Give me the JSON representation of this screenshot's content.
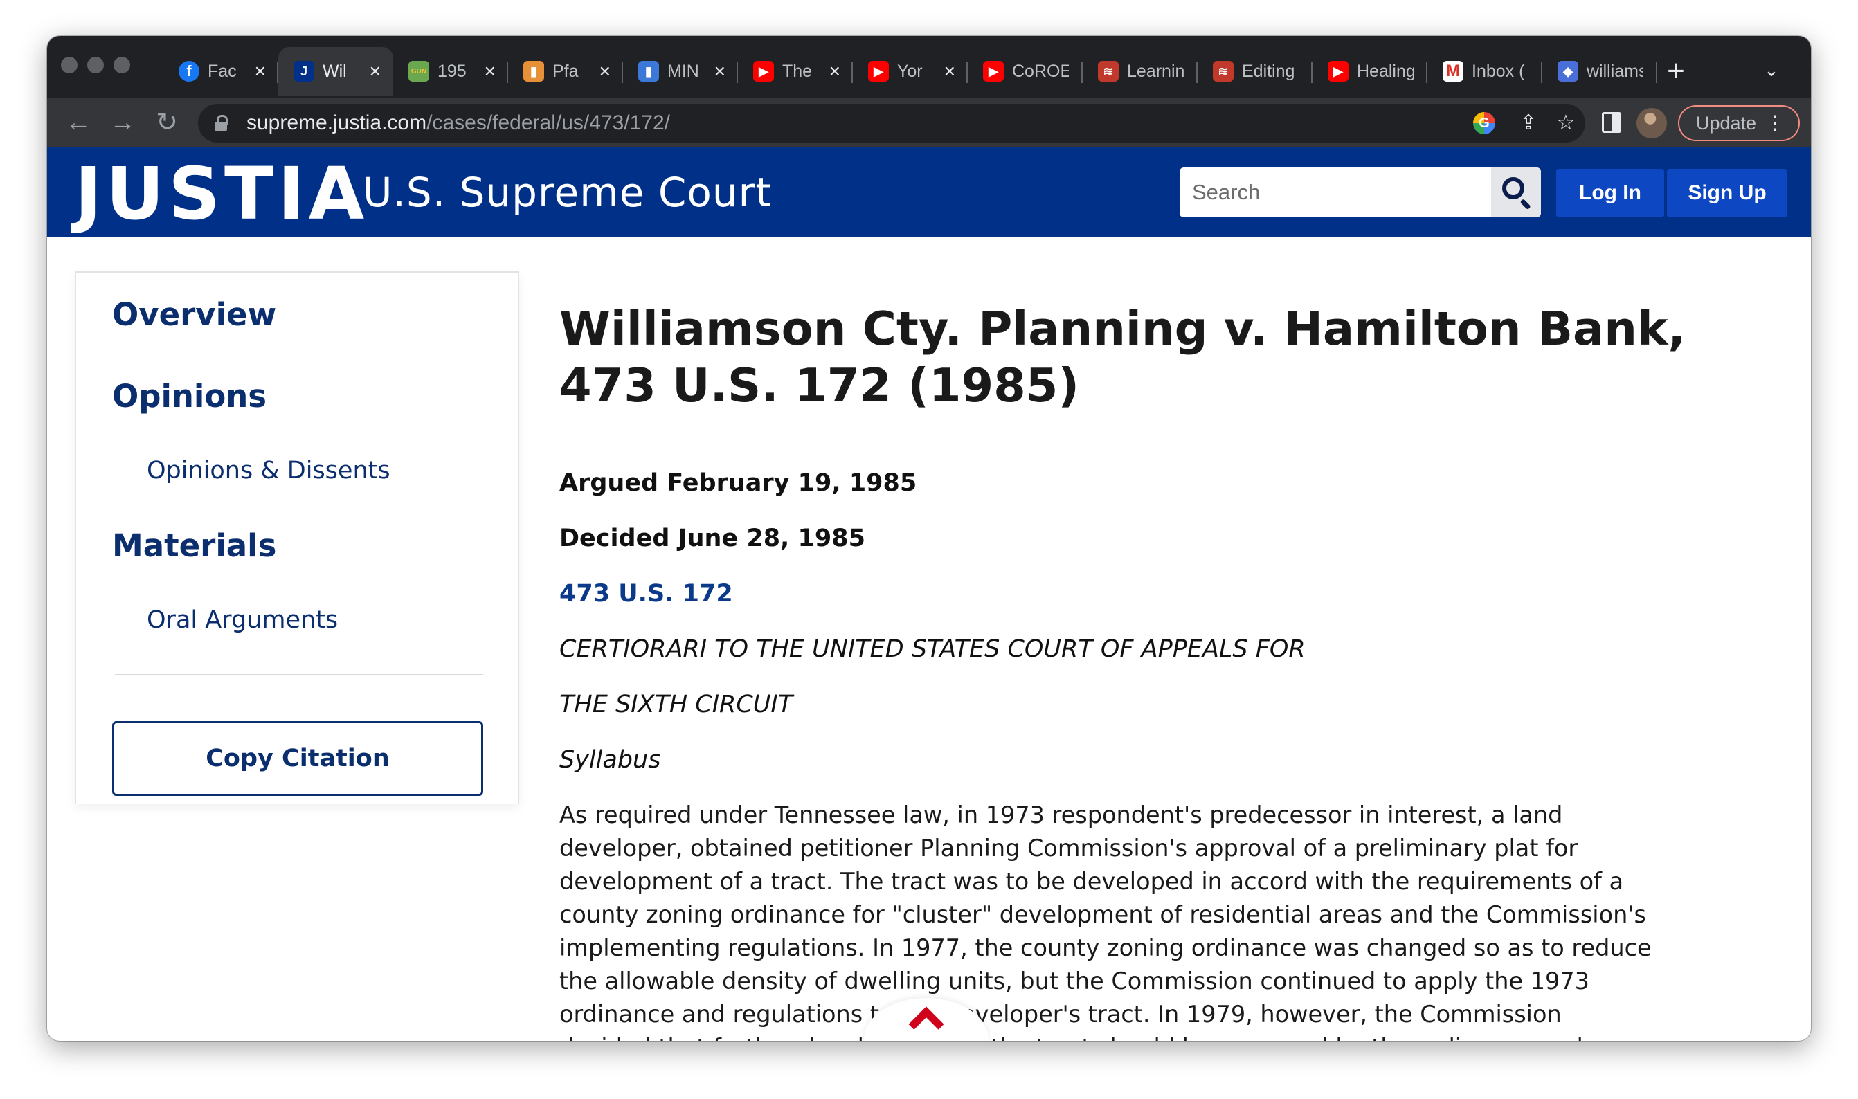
{
  "browser": {
    "tabs": [
      {
        "title": "Fac",
        "favicon": "facebook-icon",
        "color": "#1877f2",
        "glyph": "f",
        "active": false
      },
      {
        "title": "Wil",
        "favicon": "justia-icon",
        "color": "#003087",
        "glyph": "J",
        "active": true
      },
      {
        "title": "195",
        "favicon": "gun-icon",
        "color": "#6aa84f",
        "glyph": "GUN",
        "active": false
      },
      {
        "title": "Pfa",
        "favicon": "bars-chart-icon",
        "color": "#e69138",
        "glyph": "▮",
        "active": false
      },
      {
        "title": "MIN",
        "favicon": "bars-chart-icon",
        "color": "#3c78d8",
        "glyph": "▮",
        "active": false
      },
      {
        "title": "The",
        "favicon": "youtube-icon",
        "color": "#ff0000",
        "glyph": "▶",
        "active": false
      },
      {
        "title": "Yor",
        "favicon": "youtube-icon",
        "color": "#ff0000",
        "glyph": "▶",
        "active": false
      },
      {
        "title": "CoROE",
        "favicon": "youtube-icon",
        "color": "#ff0000",
        "glyph": "▶",
        "active": false
      },
      {
        "title": "Learnin",
        "favicon": "planner-icon",
        "color": "#c0392b",
        "glyph": "≋",
        "active": false
      },
      {
        "title": "Editing",
        "favicon": "planner-icon",
        "color": "#c0392b",
        "glyph": "≋",
        "active": false
      },
      {
        "title": "Healing",
        "favicon": "youtube-icon",
        "color": "#ff0000",
        "glyph": "▶",
        "active": false
      },
      {
        "title": "Inbox (",
        "favicon": "gmail-icon",
        "color": "#ffffff",
        "glyph": "M",
        "active": false
      },
      {
        "title": "williams",
        "favicon": "graduation-cap-icon",
        "color": "#4a6fd8",
        "glyph": "◆",
        "active": false
      }
    ],
    "url_host": "supreme.justia.com",
    "url_path": "/cases/federal/us/473/172/",
    "update_label": "Update"
  },
  "header": {
    "logo": "JUSTIA",
    "section": "U.S. Supreme Court",
    "search_placeholder": "Search",
    "login_label": "Log In",
    "signup_label": "Sign Up"
  },
  "sidebar": {
    "overview": "Overview",
    "opinions": "Opinions",
    "opinions_dissents": "Opinions & Dissents",
    "materials": "Materials",
    "oral_arguments": "Oral Arguments",
    "copy_citation": "Copy Citation"
  },
  "case": {
    "title": "Williamson Cty. Planning v. Hamilton Bank, 473 U.S. 172 (1985)",
    "argued": "Argued February 19, 1985",
    "decided": "Decided June 28, 1985",
    "citation": "473 U.S. 172",
    "certiorari_line1": "CERTIORARI TO THE UNITED STATES COURT OF APPEALS FOR",
    "certiorari_line2": "THE SIXTH CIRCUIT",
    "syllabus_label": "Syllabus",
    "syllabus_text": "As required under Tennessee law, in 1973 respondent's predecessor in interest, a land developer, obtained petitioner Planning Commission's approval of a preliminary plat for development of a tract. The tract was to be developed in accord with the requirements of a county zoning ordinance for \"cluster\" development of residential areas and the Commission's implementing regulations. In 1977, the county zoning ordinance was changed so as to reduce the allowable density of dwelling units, but the Commission continued to apply the 1973 ordinance and regulations to the developer's tract. In 1979, however, the Commission decided that further development of the tract should be governed by the ordinance and regulations then in effect. The Commission thereafter disapproved plats proposing further development of the remainder of the tract on various grounds, including failure to comply with"
  }
}
